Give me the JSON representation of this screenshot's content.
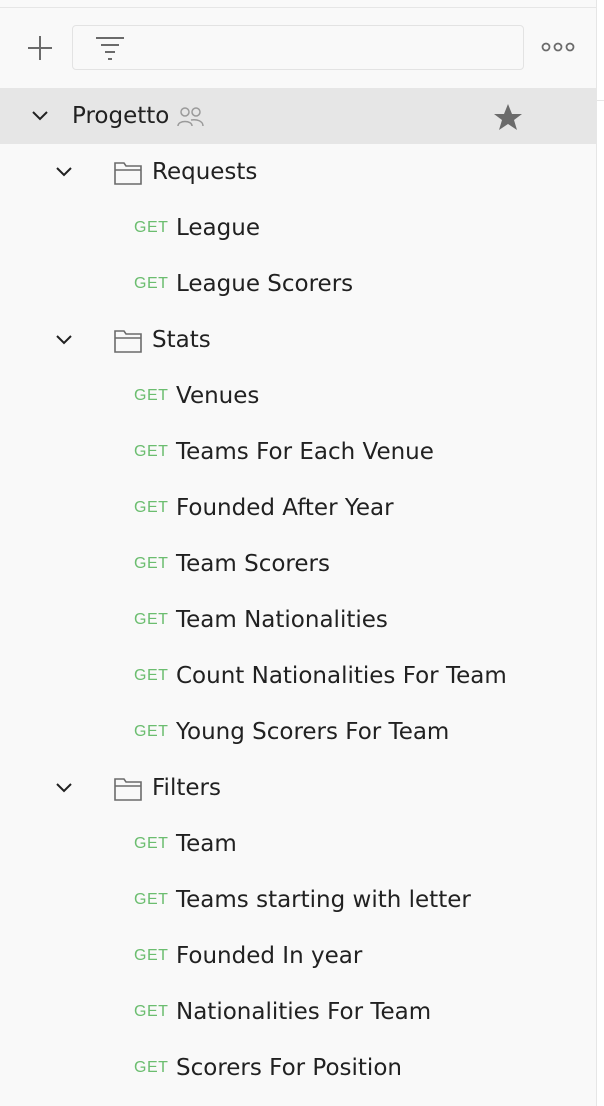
{
  "toolbar": {
    "filter_placeholder": "",
    "add_icon": "plus-icon",
    "filter_icon": "filter-lines-icon",
    "more_icon": "more-horizontal-icon"
  },
  "collection": {
    "name": "Progetto",
    "shared_icon": "people-icon",
    "starred": true,
    "star_icon": "star-icon"
  },
  "folders": [
    {
      "name": "Requests",
      "requests": [
        {
          "method": "GET",
          "name": "League"
        },
        {
          "method": "GET",
          "name": "League Scorers"
        }
      ]
    },
    {
      "name": "Stats",
      "requests": [
        {
          "method": "GET",
          "name": "Venues"
        },
        {
          "method": "GET",
          "name": "Teams For Each Venue"
        },
        {
          "method": "GET",
          "name": "Founded After Year"
        },
        {
          "method": "GET",
          "name": "Team Scorers"
        },
        {
          "method": "GET",
          "name": "Team Nationalities"
        },
        {
          "method": "GET",
          "name": "Count Nationalities For Team"
        },
        {
          "method": "GET",
          "name": "Young Scorers For Team"
        }
      ]
    },
    {
      "name": "Filters",
      "requests": [
        {
          "method": "GET",
          "name": "Team"
        },
        {
          "method": "GET",
          "name": "Teams starting with letter"
        },
        {
          "method": "GET",
          "name": "Founded In year"
        },
        {
          "method": "GET",
          "name": "Nationalities For Team"
        },
        {
          "method": "GET",
          "name": "Scorers For Position"
        }
      ]
    }
  ],
  "colors": {
    "get_method": "#6bbd6f",
    "selected_row": "#e6e6e6",
    "icon_gray": "#6b6b6b",
    "text": "#212121"
  }
}
